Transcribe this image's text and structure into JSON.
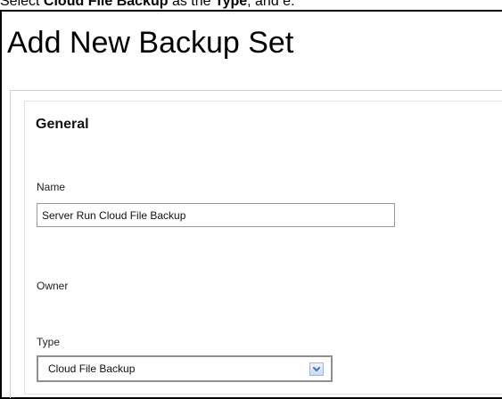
{
  "document_text": {
    "part1": "Select ",
    "part2": "Cloud File Backup",
    "part3": " as the ",
    "part4": "Type",
    "part5": ", and e."
  },
  "page": {
    "title": "Add New Backup Set"
  },
  "general_section": {
    "heading": "General",
    "name_label": "Name",
    "name_value": "Server Run Cloud File Backup",
    "owner_label": "Owner",
    "type_label": "Type",
    "type_value": "Cloud File Backup",
    "dropdown_icon": "chevron-down-icon"
  },
  "colors": {
    "border": "#9a9a9a",
    "frame": "#000000",
    "dropdown_arrow": "#4b73b0"
  }
}
